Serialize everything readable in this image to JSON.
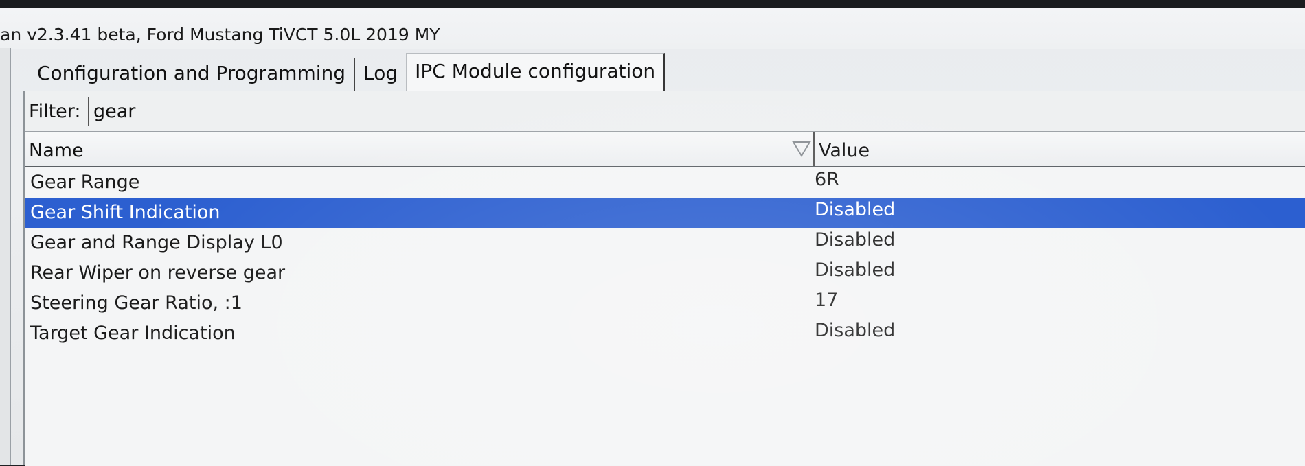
{
  "window": {
    "title": "an v2.3.41 beta, Ford Mustang TiVCT 5.0L 2019 MY"
  },
  "tabs": [
    {
      "label": "Configuration and Programming",
      "active": false
    },
    {
      "label": "Log",
      "active": false
    },
    {
      "label": "IPC Module configuration",
      "active": true
    }
  ],
  "filter": {
    "label": "Filter:",
    "value": "gear"
  },
  "table": {
    "columns": {
      "name": "Name",
      "value": "Value"
    },
    "rows": [
      {
        "name": "Gear Range",
        "value": "6R",
        "selected": false
      },
      {
        "name": "Gear Shift Indication",
        "value": "Disabled",
        "selected": true
      },
      {
        "name": "Gear and Range Display L0",
        "value": "Disabled",
        "selected": false
      },
      {
        "name": "Rear Wiper on reverse gear",
        "value": "Disabled",
        "selected": false
      },
      {
        "name": "Steering Gear Ratio, :1",
        "value": "17",
        "selected": false
      },
      {
        "name": "Target Gear Indication",
        "value": "Disabled",
        "selected": false
      }
    ]
  },
  "icons": {
    "sort": "sort-filter-icon"
  },
  "colors": {
    "selection": "#2c5fd0",
    "selection_text": "#ffffff"
  }
}
